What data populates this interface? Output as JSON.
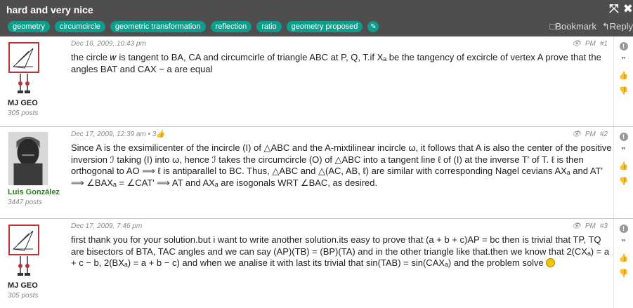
{
  "topic": {
    "title": "hard and very nice",
    "tags": [
      "geometry",
      "circumcircle",
      "geometric transformation",
      "reflection",
      "ratio",
      "geometry proposed"
    ],
    "edit_icon": "pencil-icon",
    "bookmark_label": "□Bookmark",
    "reply_label": "↰Reply",
    "expand_icon": "expand-icon",
    "close_icon": "close-icon"
  },
  "posts": [
    {
      "author": "MJ GEO",
      "post_count": "305 posts",
      "meta": "Dec 16, 2009, 10:43 pm",
      "pm_label": "PM",
      "number": "#1",
      "body": "the circle 𝑤 is tangent to BA, CA and circumcirle of triangle ABC at P, Q, T.if Xₐ be the tangency of excircle of vertex A prove that the angles BAT and CAX − a are equal"
    },
    {
      "author": "Luis González",
      "post_count": "3447 posts",
      "meta": "Dec 17, 2009, 12:39 am • 3👍",
      "pm_label": "PM",
      "number": "#2",
      "body": "Since A is the exsimilicenter of the incircle (I) of △ABC and the A-mixtilinear incircle ω, it follows that A is also the center of the positive inversion ℐ taking (I) into ω, hence ℐ takes the circumcircle (O) of △ABC into a tangent line ℓ of (I) at the inverse T′ of T. ℓ is then orthogonal to AO ⟹ ℓ is antiparallel to BC. Thus, △ABC and △(AC, AB, ℓ) are similar with corresponding Nagel cevians AXₐ and AT′ ⟹ ∠BAXₐ = ∠CAT′ ⟹ AT and AXₐ are isogonals WRT ∠BAC, as desired."
    },
    {
      "author": "MJ GEO",
      "post_count": "305 posts",
      "meta": "Dec 17, 2009, 7:46 pm",
      "pm_label": "PM",
      "number": "#3",
      "body": "first thank you for your solution.but i want to write another solution.its easy to prove that (a + b + c)AP = bc then is trivial that TP, TQ are bisectors of BTA, TAC angles and we can say (AP)(TB) = (BP)(TA) and in the other triangle like that.then we know that 2(CXₐ) = a + c − b, 2(BXₐ) = a + b − c) and when we analise it with last its trivial that sin(TAB) = sin(CAXₐ) and the problem solve"
    }
  ],
  "side_icons": [
    "report-icon",
    "quote-icon",
    "like-icon",
    "dislike-icon"
  ],
  "colors": {
    "header_bg": "#4e4e4e",
    "tag_bg": "#0e9c8c",
    "author_green": "#2e7d1f"
  }
}
